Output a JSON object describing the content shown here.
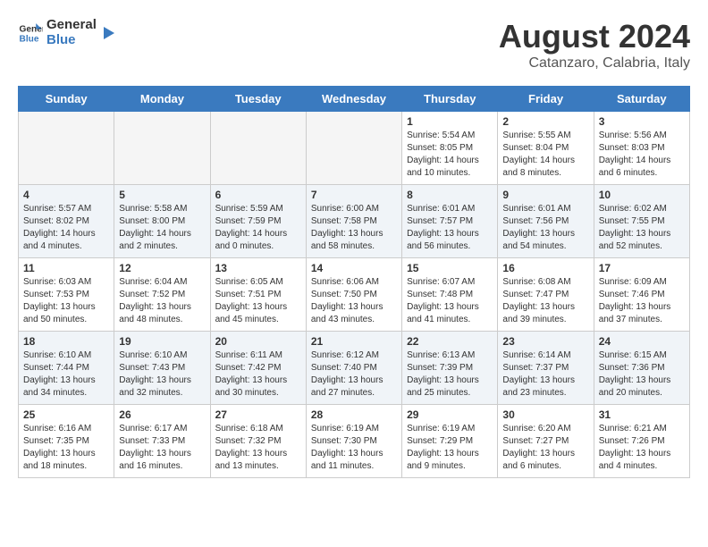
{
  "header": {
    "logo_general": "General",
    "logo_blue": "Blue",
    "month_year": "August 2024",
    "location": "Catanzaro, Calabria, Italy"
  },
  "days_of_week": [
    "Sunday",
    "Monday",
    "Tuesday",
    "Wednesday",
    "Thursday",
    "Friday",
    "Saturday"
  ],
  "weeks": [
    [
      {
        "num": "",
        "empty": true
      },
      {
        "num": "",
        "empty": true
      },
      {
        "num": "",
        "empty": true
      },
      {
        "num": "",
        "empty": true
      },
      {
        "num": "1",
        "sunrise": "5:54 AM",
        "sunset": "8:05 PM",
        "daylight": "14 hours and 10 minutes."
      },
      {
        "num": "2",
        "sunrise": "5:55 AM",
        "sunset": "8:04 PM",
        "daylight": "14 hours and 8 minutes."
      },
      {
        "num": "3",
        "sunrise": "5:56 AM",
        "sunset": "8:03 PM",
        "daylight": "14 hours and 6 minutes."
      }
    ],
    [
      {
        "num": "4",
        "sunrise": "5:57 AM",
        "sunset": "8:02 PM",
        "daylight": "14 hours and 4 minutes."
      },
      {
        "num": "5",
        "sunrise": "5:58 AM",
        "sunset": "8:00 PM",
        "daylight": "14 hours and 2 minutes."
      },
      {
        "num": "6",
        "sunrise": "5:59 AM",
        "sunset": "7:59 PM",
        "daylight": "14 hours and 0 minutes."
      },
      {
        "num": "7",
        "sunrise": "6:00 AM",
        "sunset": "7:58 PM",
        "daylight": "13 hours and 58 minutes."
      },
      {
        "num": "8",
        "sunrise": "6:01 AM",
        "sunset": "7:57 PM",
        "daylight": "13 hours and 56 minutes."
      },
      {
        "num": "9",
        "sunrise": "6:01 AM",
        "sunset": "7:56 PM",
        "daylight": "13 hours and 54 minutes."
      },
      {
        "num": "10",
        "sunrise": "6:02 AM",
        "sunset": "7:55 PM",
        "daylight": "13 hours and 52 minutes."
      }
    ],
    [
      {
        "num": "11",
        "sunrise": "6:03 AM",
        "sunset": "7:53 PM",
        "daylight": "13 hours and 50 minutes."
      },
      {
        "num": "12",
        "sunrise": "6:04 AM",
        "sunset": "7:52 PM",
        "daylight": "13 hours and 48 minutes."
      },
      {
        "num": "13",
        "sunrise": "6:05 AM",
        "sunset": "7:51 PM",
        "daylight": "13 hours and 45 minutes."
      },
      {
        "num": "14",
        "sunrise": "6:06 AM",
        "sunset": "7:50 PM",
        "daylight": "13 hours and 43 minutes."
      },
      {
        "num": "15",
        "sunrise": "6:07 AM",
        "sunset": "7:48 PM",
        "daylight": "13 hours and 41 minutes."
      },
      {
        "num": "16",
        "sunrise": "6:08 AM",
        "sunset": "7:47 PM",
        "daylight": "13 hours and 39 minutes."
      },
      {
        "num": "17",
        "sunrise": "6:09 AM",
        "sunset": "7:46 PM",
        "daylight": "13 hours and 37 minutes."
      }
    ],
    [
      {
        "num": "18",
        "sunrise": "6:10 AM",
        "sunset": "7:44 PM",
        "daylight": "13 hours and 34 minutes."
      },
      {
        "num": "19",
        "sunrise": "6:10 AM",
        "sunset": "7:43 PM",
        "daylight": "13 hours and 32 minutes."
      },
      {
        "num": "20",
        "sunrise": "6:11 AM",
        "sunset": "7:42 PM",
        "daylight": "13 hours and 30 minutes."
      },
      {
        "num": "21",
        "sunrise": "6:12 AM",
        "sunset": "7:40 PM",
        "daylight": "13 hours and 27 minutes."
      },
      {
        "num": "22",
        "sunrise": "6:13 AM",
        "sunset": "7:39 PM",
        "daylight": "13 hours and 25 minutes."
      },
      {
        "num": "23",
        "sunrise": "6:14 AM",
        "sunset": "7:37 PM",
        "daylight": "13 hours and 23 minutes."
      },
      {
        "num": "24",
        "sunrise": "6:15 AM",
        "sunset": "7:36 PM",
        "daylight": "13 hours and 20 minutes."
      }
    ],
    [
      {
        "num": "25",
        "sunrise": "6:16 AM",
        "sunset": "7:35 PM",
        "daylight": "13 hours and 18 minutes."
      },
      {
        "num": "26",
        "sunrise": "6:17 AM",
        "sunset": "7:33 PM",
        "daylight": "13 hours and 16 minutes."
      },
      {
        "num": "27",
        "sunrise": "6:18 AM",
        "sunset": "7:32 PM",
        "daylight": "13 hours and 13 minutes."
      },
      {
        "num": "28",
        "sunrise": "6:19 AM",
        "sunset": "7:30 PM",
        "daylight": "13 hours and 11 minutes."
      },
      {
        "num": "29",
        "sunrise": "6:19 AM",
        "sunset": "7:29 PM",
        "daylight": "13 hours and 9 minutes."
      },
      {
        "num": "30",
        "sunrise": "6:20 AM",
        "sunset": "7:27 PM",
        "daylight": "13 hours and 6 minutes."
      },
      {
        "num": "31",
        "sunrise": "6:21 AM",
        "sunset": "7:26 PM",
        "daylight": "13 hours and 4 minutes."
      }
    ]
  ]
}
